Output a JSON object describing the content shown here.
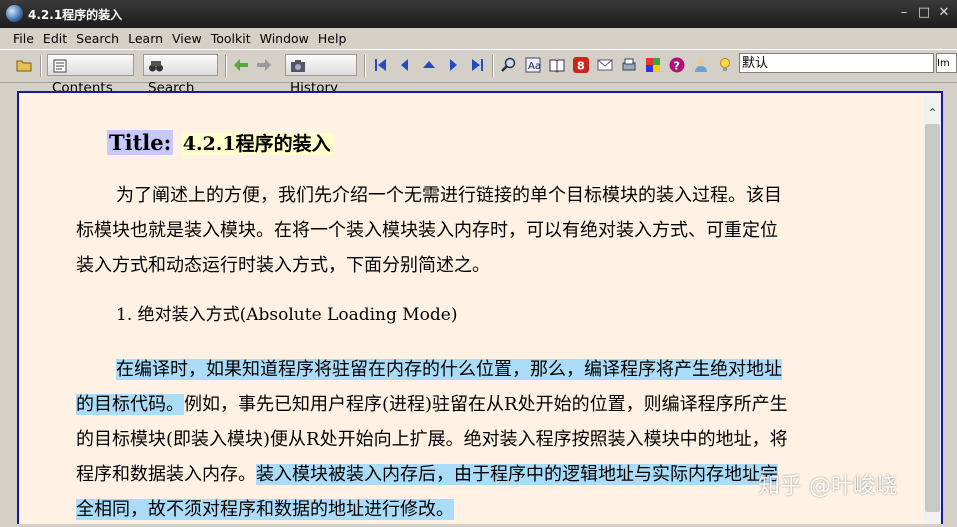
{
  "window": {
    "title": "4.2.1程序的装入"
  },
  "menu": [
    "File",
    "Edit",
    "Search",
    "Learn",
    "View",
    "Toolkit",
    "Window",
    "Help"
  ],
  "toolbar": {
    "contents_label": "Contents",
    "search_label": "Search",
    "history_label": "History",
    "search_value": "默认",
    "im_label": "Im"
  },
  "document": {
    "title_label": "Title:",
    "title_value": "4.2.1程序的装入",
    "para1_lines": [
      "为了阐述上的方便，我们先介绍一个无需进行链接的单个目标模块的装入过程。该目",
      "标模块也就是装入模块。在将一个装入模块装入内存时，可以有绝对装入方式、可重定位",
      "装入方式和动态运行时装入方式，下面分别简述之。"
    ],
    "list_item": "1.  绝对装入方式(Absolute Loading Mode)",
    "para2_line1": "在编译时，如果知道程序将驻留在内存的什么位置，那么，编译程序将产生绝对地址",
    "para2_line2_hl": "的目标代码。",
    "para2_line2_rest": "例如，事先已知用户程序(进程)驻留在从R处开始的位置，则编译程序所产生",
    "para2_line3": "的目标模块(即装入模块)便从R处开始向上扩展。绝对装入程序按照装入模块中的地址，将",
    "para2_line4_plain": "程序和数据装入内存。",
    "para2_line4_hl": "装入模块被装入内存后，由于程序中的逻辑地址与实际内存地址完",
    "para2_line5_hl": "全相同，故不须对程序和数据的地址进行修改。"
  },
  "watermark": "知乎 @叶峻峣"
}
